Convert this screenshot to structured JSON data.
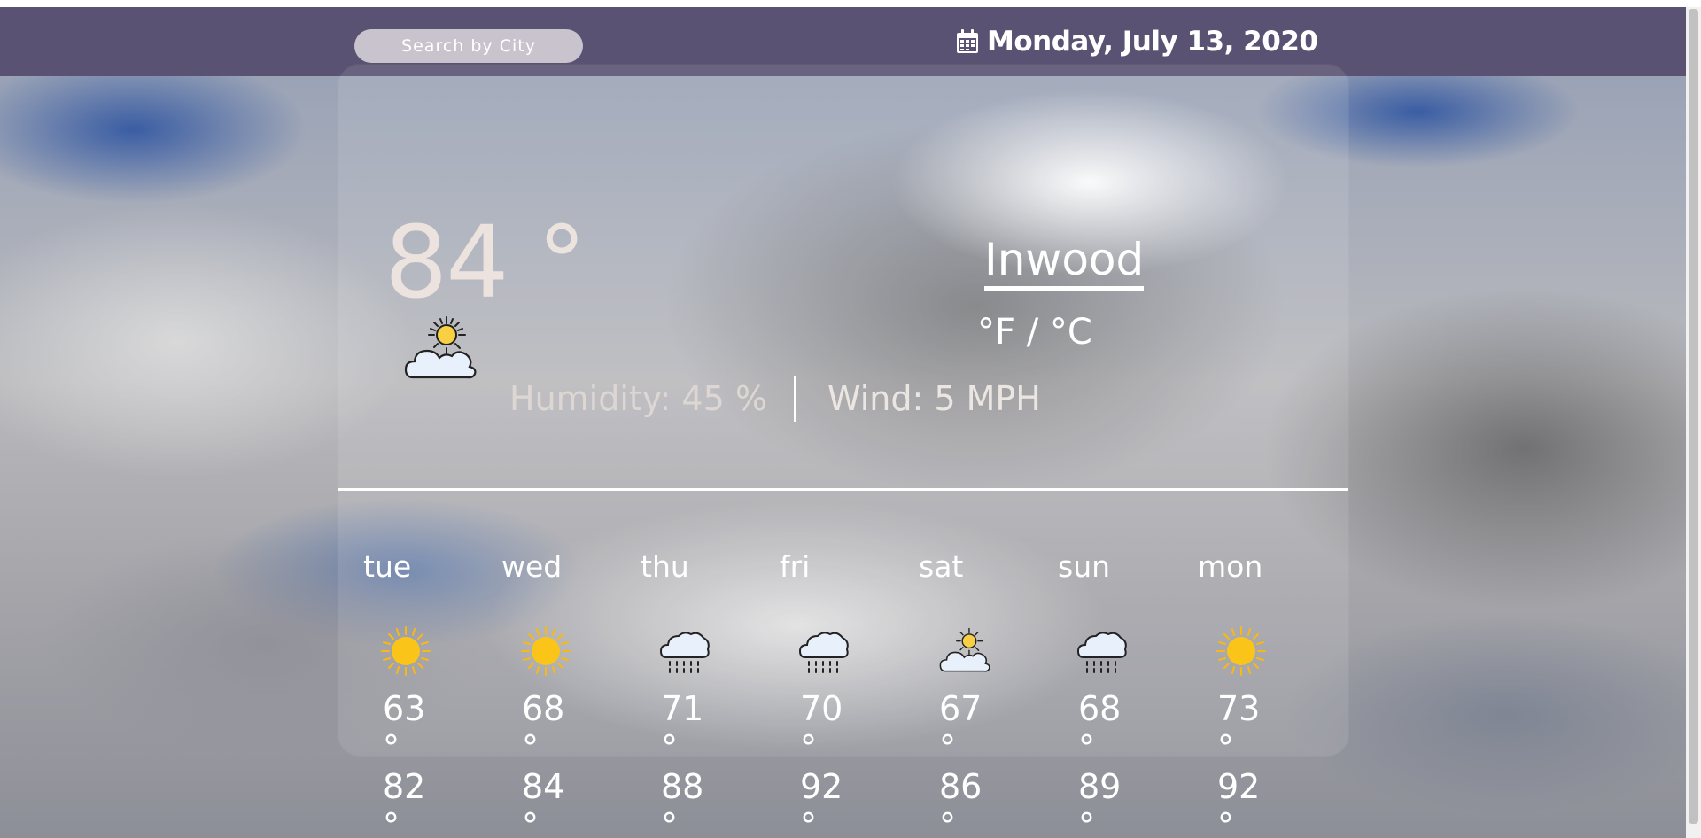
{
  "header": {
    "search_placeholder": "Search by City",
    "date": "Monday, July 13, 2020",
    "calendar_icon": "calendar-icon",
    "bar_color": "#595272"
  },
  "current": {
    "temperature": "84 °",
    "icon": "partly-sunny-icon",
    "city": "Inwood",
    "units_toggle": "°F / °C",
    "humidity": "Humidity: 45 %",
    "wind": "Wind: 5 MPH"
  },
  "forecast": [
    {
      "day": "tue",
      "icon": "sun-icon",
      "low": "63 °",
      "high": "82 °"
    },
    {
      "day": "wed",
      "icon": "sun-icon",
      "low": "68 °",
      "high": "84 °"
    },
    {
      "day": "thu",
      "icon": "rain-cloud-icon",
      "low": "71 °",
      "high": "88 °"
    },
    {
      "day": "fri",
      "icon": "rain-cloud-icon",
      "low": "70 °",
      "high": "92 °"
    },
    {
      "day": "sat",
      "icon": "partly-sunny-icon",
      "low": "67 °",
      "high": "86 °"
    },
    {
      "day": "sun",
      "icon": "rain-cloud-icon",
      "low": "68 °",
      "high": "89 °"
    },
    {
      "day": "mon",
      "icon": "sun-icon",
      "low": "73 °",
      "high": "92 °"
    }
  ]
}
